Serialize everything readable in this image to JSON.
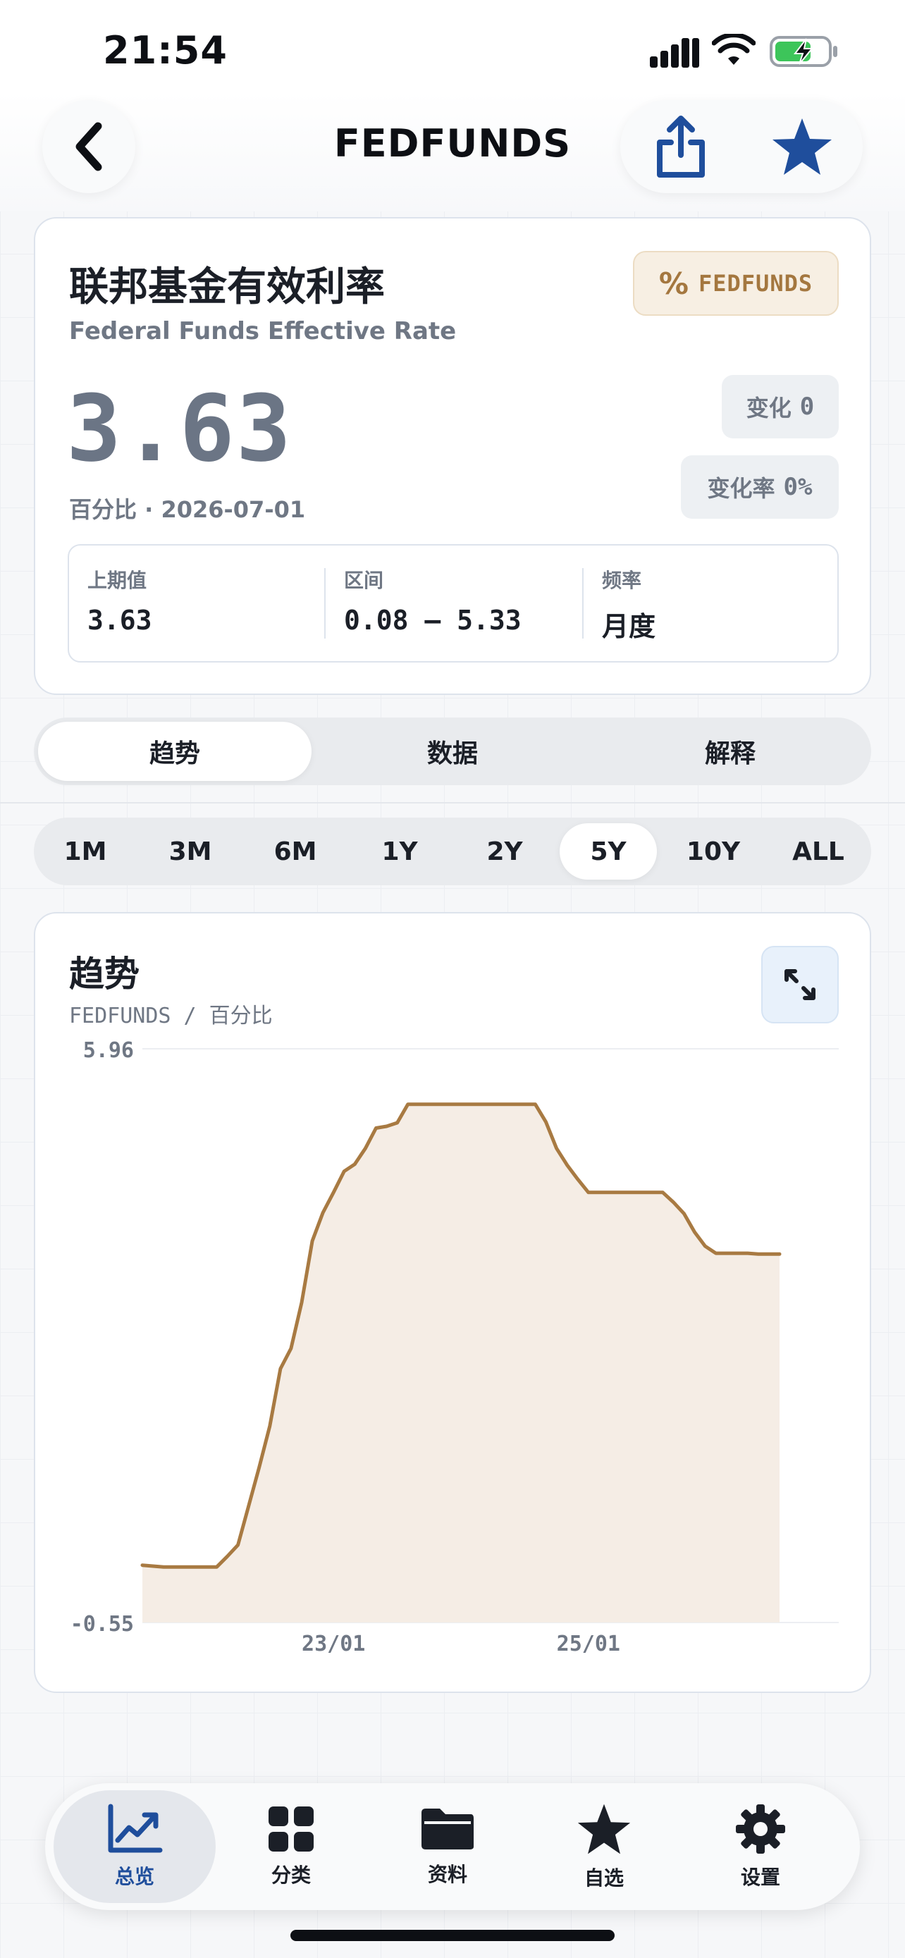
{
  "status": {
    "time": "21:54"
  },
  "header": {
    "title": "FEDFUNDS"
  },
  "summary": {
    "cn_title": "联邦基金有效利率",
    "en_title": "Federal Funds Effective Rate",
    "badge_code": "FEDFUNDS",
    "badge_symbol": "%",
    "value": "3.63",
    "unit_date": "百分比 · 2026-07-01",
    "change_label": "变化",
    "change_value": "0",
    "change_rate_label": "变化率",
    "change_rate_value": "0%",
    "stats": [
      {
        "label": "上期值",
        "value": "3.63"
      },
      {
        "label": "区间",
        "value": "0.08 – 5.33"
      },
      {
        "label": "频率",
        "value": "月度"
      }
    ]
  },
  "view_tabs": [
    {
      "label": "趋势",
      "active": true
    },
    {
      "label": "数据",
      "active": false
    },
    {
      "label": "解释",
      "active": false
    }
  ],
  "range_tabs": [
    {
      "label": "1M",
      "active": false
    },
    {
      "label": "3M",
      "active": false
    },
    {
      "label": "6M",
      "active": false
    },
    {
      "label": "1Y",
      "active": false
    },
    {
      "label": "2Y",
      "active": false
    },
    {
      "label": "5Y",
      "active": true
    },
    {
      "label": "10Y",
      "active": false
    },
    {
      "label": "ALL",
      "active": false
    }
  ],
  "chart": {
    "title": "趋势",
    "subtitle": "FEDFUNDS / 百分比"
  },
  "chart_data": {
    "type": "area",
    "x": [
      "2021-07",
      "2021-08",
      "2021-09",
      "2021-10",
      "2021-11",
      "2021-12",
      "2022-01",
      "2022-02",
      "2022-03",
      "2022-04",
      "2022-05",
      "2022-06",
      "2022-07",
      "2022-08",
      "2022-09",
      "2022-10",
      "2022-11",
      "2022-12",
      "2023-01",
      "2023-02",
      "2023-03",
      "2023-04",
      "2023-05",
      "2023-06",
      "2023-07",
      "2023-08",
      "2023-09",
      "2023-10",
      "2023-11",
      "2023-12",
      "2024-01",
      "2024-02",
      "2024-03",
      "2024-04",
      "2024-05",
      "2024-06",
      "2024-07",
      "2024-08",
      "2024-09",
      "2024-10",
      "2024-11",
      "2024-12",
      "2025-01",
      "2025-02",
      "2025-03",
      "2025-04",
      "2025-05",
      "2025-06",
      "2025-07",
      "2025-08",
      "2025-09",
      "2025-10",
      "2025-11",
      "2025-12",
      "2026-01",
      "2026-02",
      "2026-03",
      "2026-04",
      "2026-05",
      "2026-06",
      "2026-07"
    ],
    "values": [
      0.1,
      0.09,
      0.08,
      0.08,
      0.08,
      0.08,
      0.08,
      0.08,
      0.2,
      0.33,
      0.77,
      1.21,
      1.68,
      2.33,
      2.56,
      3.08,
      3.78,
      4.1,
      4.33,
      4.57,
      4.65,
      4.83,
      5.06,
      5.08,
      5.12,
      5.33,
      5.33,
      5.33,
      5.33,
      5.33,
      5.33,
      5.33,
      5.33,
      5.33,
      5.33,
      5.33,
      5.33,
      5.33,
      5.13,
      4.83,
      4.64,
      4.48,
      4.33,
      4.33,
      4.33,
      4.33,
      4.33,
      4.33,
      4.33,
      4.33,
      4.22,
      4.09,
      3.88,
      3.72,
      3.64,
      3.64,
      3.64,
      3.64,
      3.63,
      3.63,
      3.63
    ],
    "ylim": [
      -0.55,
      5.96
    ],
    "y_ticks": [
      "5.96",
      "-0.55"
    ],
    "x_ticks": [
      {
        "label": "23/01",
        "at": "2023-01"
      },
      {
        "label": "25/01",
        "at": "2025-01"
      }
    ],
    "color": "#a87a42",
    "fill": "#f5ede5"
  },
  "tabbar": [
    {
      "label": "总览",
      "icon": "chart-line-icon",
      "active": true
    },
    {
      "label": "分类",
      "icon": "grid-icon",
      "active": false
    },
    {
      "label": "资料",
      "icon": "folder-icon",
      "active": false
    },
    {
      "label": "自选",
      "icon": "star-icon",
      "active": false
    },
    {
      "label": "设置",
      "icon": "gear-icon",
      "active": false
    }
  ]
}
